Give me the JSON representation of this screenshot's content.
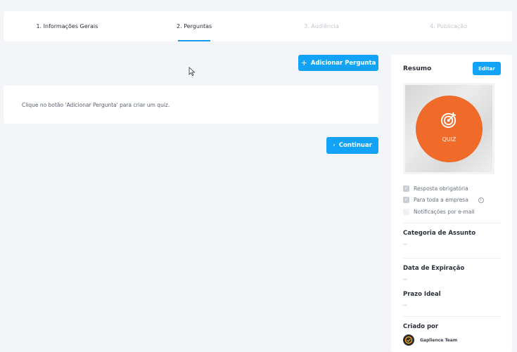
{
  "stepper": {
    "steps": [
      {
        "label": "1. Informações Gerais",
        "state": "done"
      },
      {
        "label": "2. Perguntas",
        "state": "active"
      },
      {
        "label": "3. Audiência",
        "state": "disabled"
      },
      {
        "label": "4. Publicação",
        "state": "disabled"
      }
    ]
  },
  "toolbar": {
    "add_question_label": "Adicionar Pergunta",
    "add_question_icon": "plus-icon"
  },
  "main": {
    "empty_message": "Clique no botão 'Adicionar Pergunta' para criar um quiz.",
    "continue_label": "Continuar",
    "continue_icon": "chevron-right-icon"
  },
  "summary": {
    "title": "Resumo",
    "edit_label": "Editar",
    "thumbnail_label": "QUIZ",
    "options": [
      {
        "label": "Resposta obrigatória",
        "checked": true
      },
      {
        "label": "Para toda a empresa",
        "checked": true,
        "info": "i"
      },
      {
        "label": "Notificações por e-mail",
        "checked": false
      }
    ],
    "category_title": "Categoria de Assunto",
    "category_value": "--",
    "expiration_title": "Data de Expiração",
    "expiration_value": "--",
    "ideal_title": "Prazo Ideal",
    "ideal_value": "--",
    "created_by_title": "Criado por",
    "created_by_name": "Gaplience Team"
  },
  "colors": {
    "accent": "#12a3f7",
    "quiz_orange": "#f06a2a",
    "background": "#f3f5f8"
  }
}
